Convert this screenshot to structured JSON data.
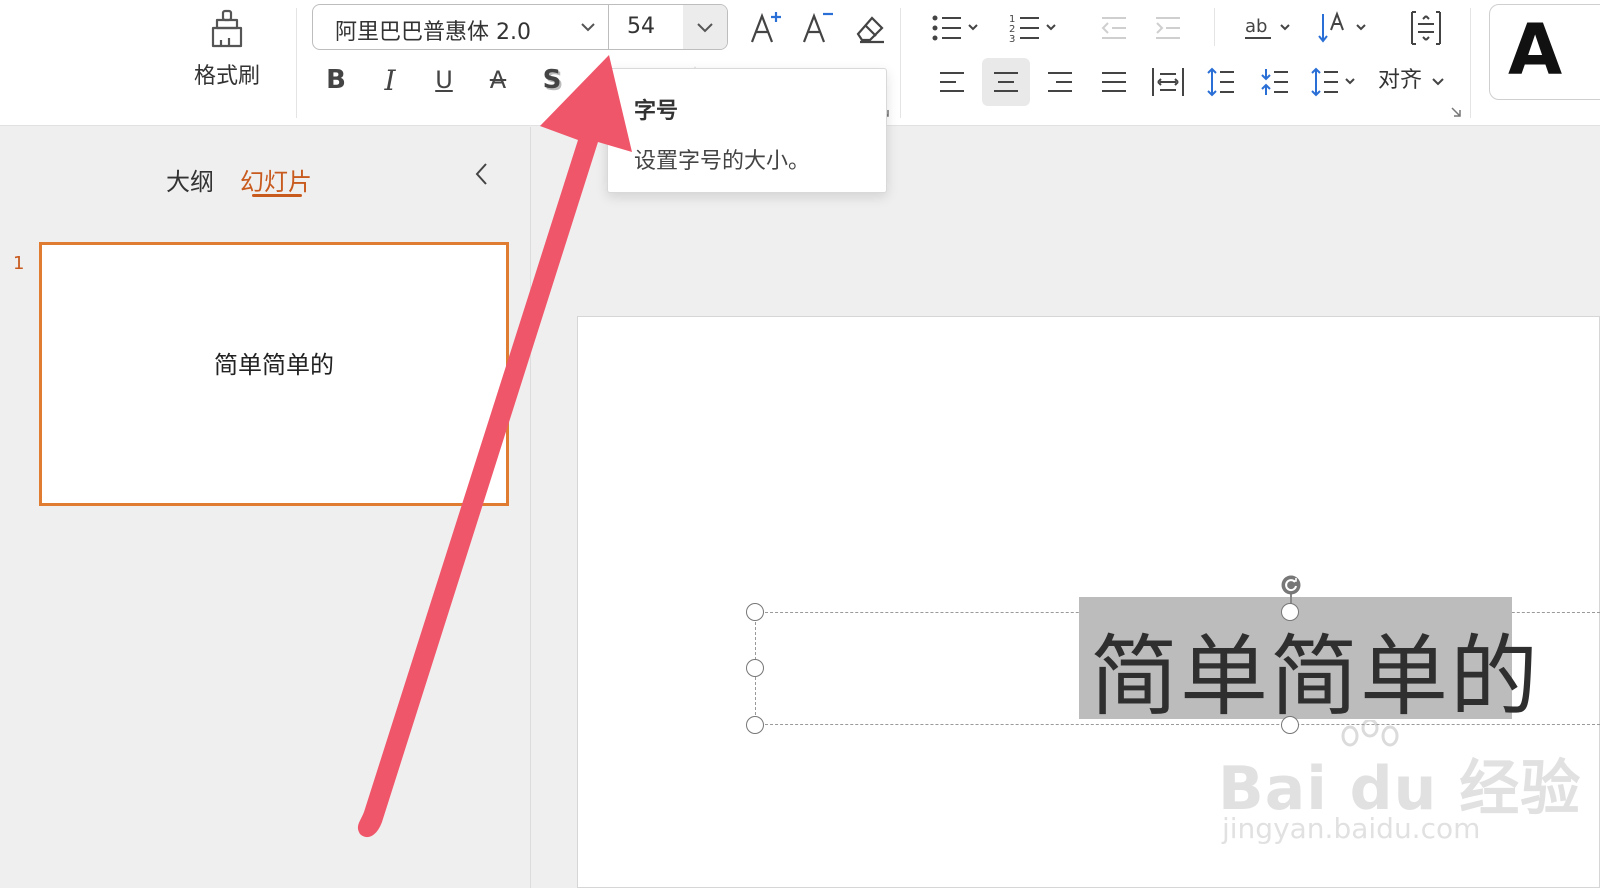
{
  "ribbon": {
    "format_painter_label": "格式刷",
    "font_name": "阿里巴巴普惠体 2.0",
    "font_size": "54",
    "align_label": "对齐",
    "style_preview": "A"
  },
  "tooltip": {
    "title": "字号",
    "description": "设置字号的大小。"
  },
  "panel": {
    "tab_outline": "大纲",
    "tab_slides": "幻灯片",
    "slide_number": "1",
    "thumbnail_text": "简单简单的"
  },
  "canvas": {
    "selected_text": "简单简单的"
  },
  "watermark": {
    "main": "Bai du 经验",
    "sub": "jingyan.baidu.com"
  },
  "colors": {
    "accent": "#c85a1e",
    "thumbnail_border": "#e07b32",
    "annotation_arrow": "#f0566a",
    "selection_highlight": "#bcbcbc"
  }
}
